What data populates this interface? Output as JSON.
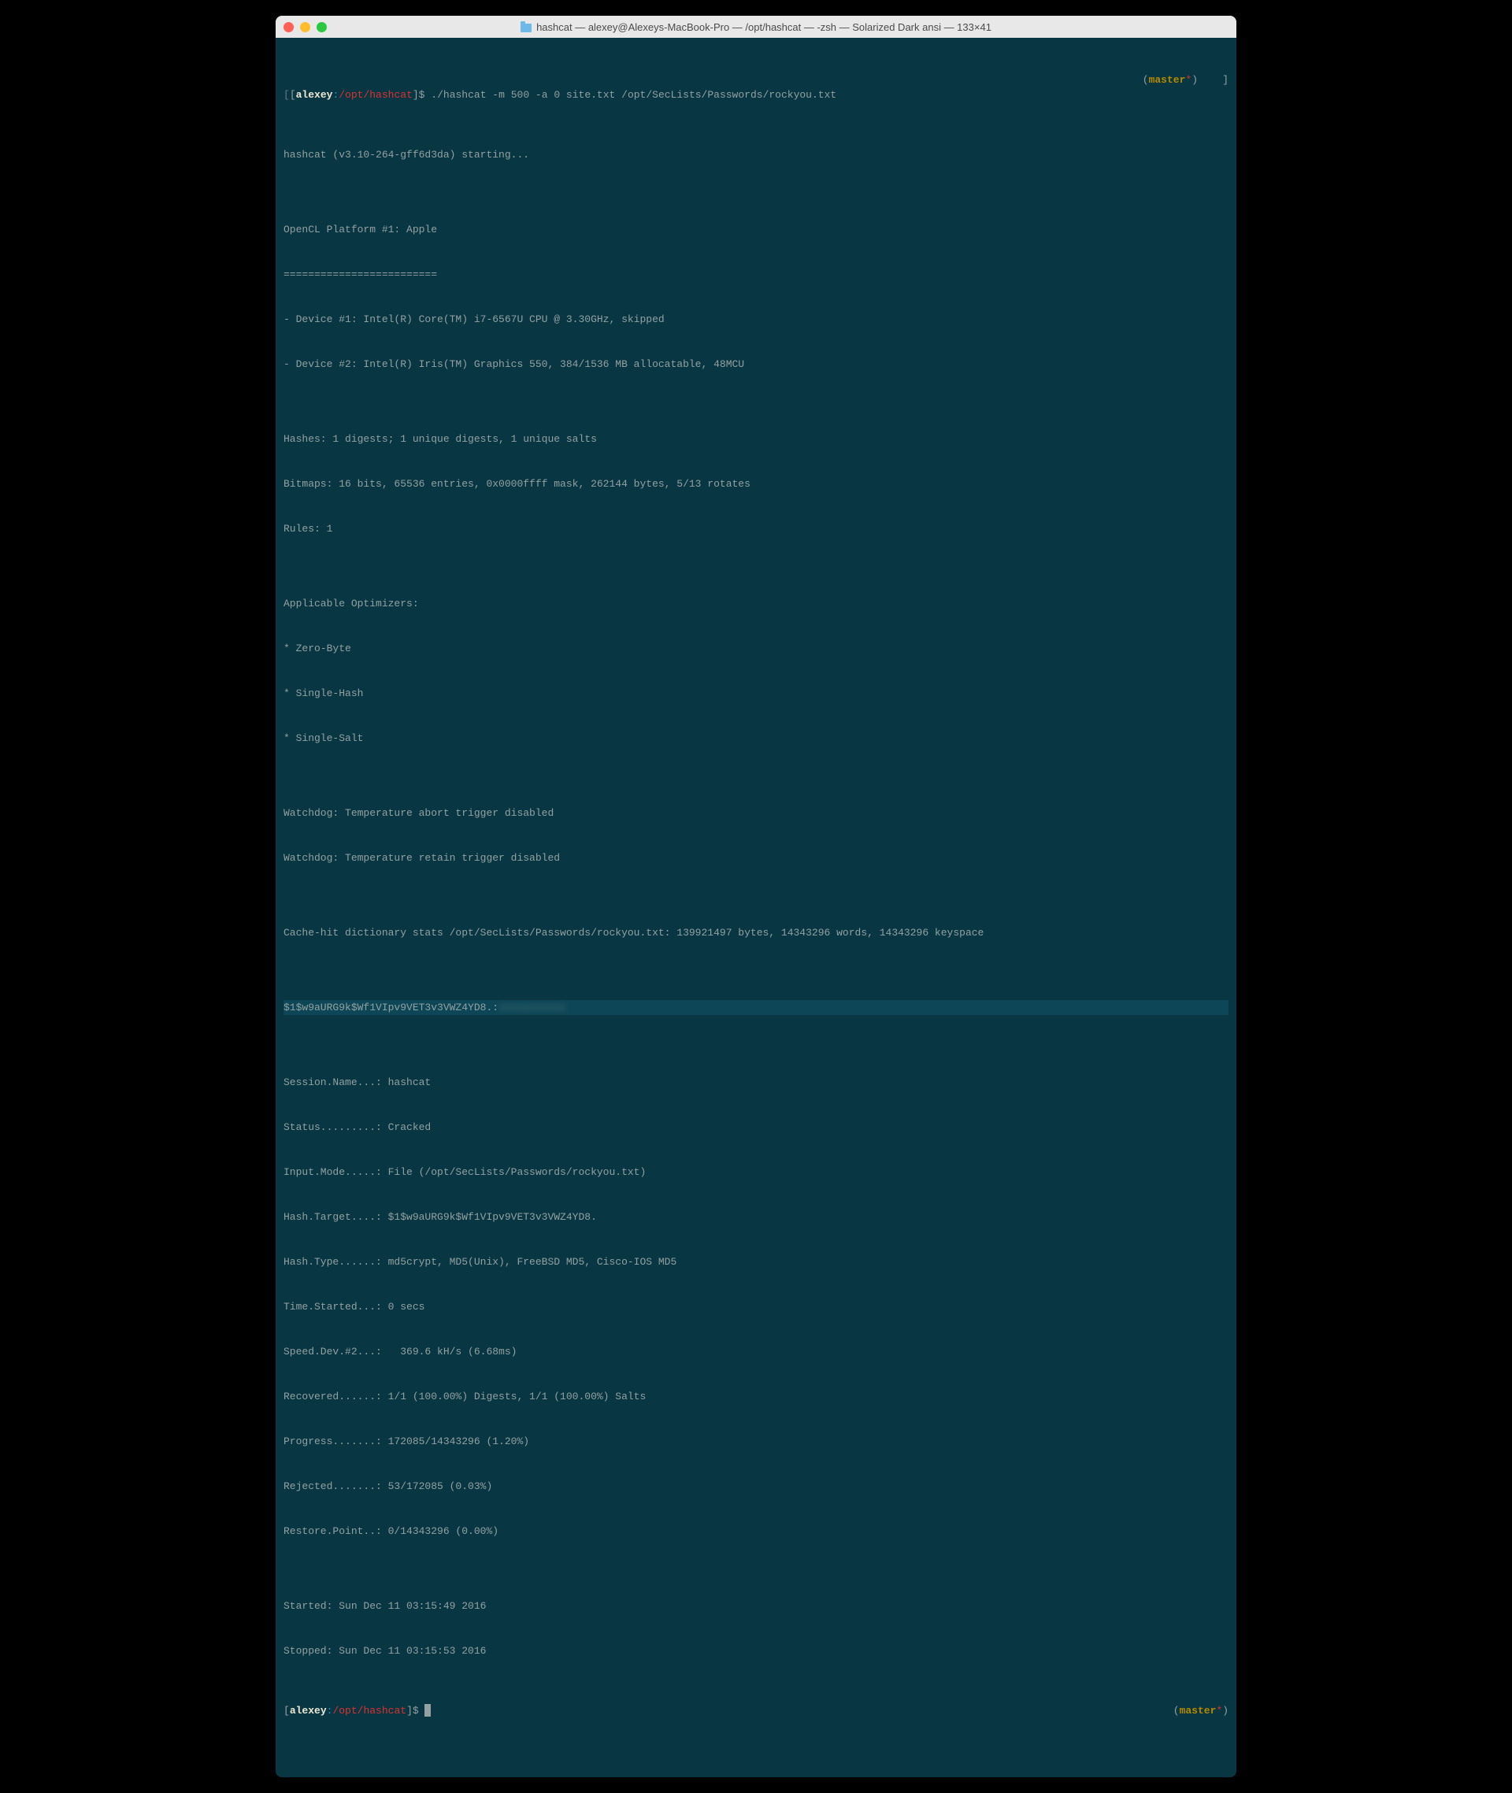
{
  "titlebar": {
    "title": "hashcat — alexey@Alexeys-MacBook-Pro — /opt/hashcat — -zsh — Solarized Dark ansi — 133×41",
    "folder_label": "hashcat"
  },
  "prompt1": {
    "lbracket": "[",
    "user": "alexey",
    "sep": ":",
    "path": "/opt/hashcat",
    "rbracket": "]$",
    "command": "./hashcat -m 500 -a 0 site.txt /opt/SecLists/Passwords/rockyou.txt",
    "branch_open": "(",
    "branch": "master",
    "branch_close": ")    ]"
  },
  "output": {
    "l0": "hashcat (v3.10-264-gff6d3da) starting...",
    "blank": "",
    "l1": "OpenCL Platform #1: Apple",
    "l2": "=========================",
    "l3": "- Device #1: Intel(R) Core(TM) i7-6567U CPU @ 3.30GHz, skipped",
    "l4": "- Device #2: Intel(R) Iris(TM) Graphics 550, 384/1536 MB allocatable, 48MCU",
    "l5": "Hashes: 1 digests; 1 unique digests, 1 unique salts",
    "l6": "Bitmaps: 16 bits, 65536 entries, 0x0000ffff mask, 262144 bytes, 5/13 rotates",
    "l7": "Rules: 1",
    "l8": "Applicable Optimizers:",
    "l9": "* Zero-Byte",
    "l10": "* Single-Hash",
    "l11": "* Single-Salt",
    "l12": "Watchdog: Temperature abort trigger disabled",
    "l13": "Watchdog: Temperature retain trigger disabled",
    "l14": "Cache-hit dictionary stats /opt/SecLists/Passwords/rockyou.txt: 139921497 bytes, 14343296 words, 14343296 keyspace",
    "l15a": "$1$w9aURG9k$Wf1VIpv9VET3v3VWZ4YD8.:",
    "l15b": "xxxxxxxxxxx",
    "l16": "Session.Name...: hashcat",
    "l17": "Status.........: Cracked",
    "l18": "Input.Mode.....: File (/opt/SecLists/Passwords/rockyou.txt)",
    "l19": "Hash.Target....: $1$w9aURG9k$Wf1VIpv9VET3v3VWZ4YD8.",
    "l20": "Hash.Type......: md5crypt, MD5(Unix), FreeBSD MD5, Cisco-IOS MD5",
    "l21": "Time.Started...: 0 secs",
    "l22": "Speed.Dev.#2...:   369.6 kH/s (6.68ms)",
    "l23": "Recovered......: 1/1 (100.00%) Digests, 1/1 (100.00%) Salts",
    "l24": "Progress.......: 172085/14343296 (1.20%)",
    "l25": "Rejected.......: 53/172085 (0.03%)",
    "l26": "Restore.Point..: 0/14343296 (0.00%)",
    "l27": "Started: Sun Dec 11 03:15:49 2016",
    "l28": "Stopped: Sun Dec 11 03:15:53 2016"
  },
  "prompt2": {
    "lbracket": "[",
    "user": "alexey",
    "sep": ":",
    "path": "/opt/hashcat",
    "rbracket": "]$ ",
    "branch_open": "(",
    "branch": "master",
    "branch_close": ")"
  }
}
